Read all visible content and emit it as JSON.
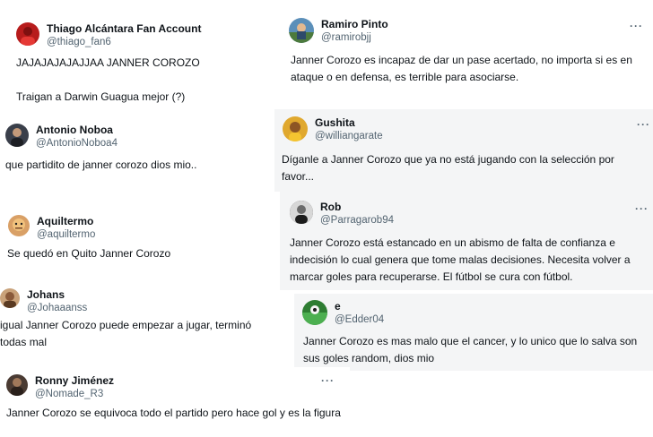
{
  "tweets": [
    {
      "name": "Thiago Alcántara Fan Account",
      "handle": "@thiago_fan6",
      "text": "JAJAJAJAJAJJAA JANNER COROZO\n\nTraigan a Darwin Guagua mejor (?)",
      "avatar": "avatar-red-jersey",
      "avatar_color": "#b71c1c"
    },
    {
      "name": "Ramiro Pinto",
      "handle": "@ramirobjj",
      "text": "Janner Corozo es incapaz de dar un pase acertado, no importa si es en ataque o en defensa, es terrible para asociarse.",
      "avatar": "avatar-outdoor-photo",
      "avatar_color": "#5b8fb9"
    },
    {
      "name": "Antonio Noboa",
      "handle": "@AntonioNoboa4",
      "text": "que partidito de janner corozo dios mio..",
      "avatar": "avatar-portrait",
      "avatar_color": "#3a3f4a"
    },
    {
      "name": "Gushita",
      "handle": "@williangarate",
      "text": "Díganle a Janner Corozo que ya no está jugando con la selección por favor...",
      "avatar": "avatar-yellow",
      "avatar_color": "#e0a82e"
    },
    {
      "name": "Aquiltermo",
      "handle": "@aquiltermo",
      "text": "Se quedó en Quito Janner Corozo",
      "avatar": "avatar-cartoon",
      "avatar_color": "#d9a066"
    },
    {
      "name": "Rob",
      "handle": "@Parragarob94",
      "text": "Janner Corozo está estancado en un abismo de falta de confianza e indecisión lo cual genera que tome malas decisiones. Necesita volver a marcar goles para recuperarse. El fútbol se cura con fútbol.",
      "avatar": "avatar-dark-portrait",
      "avatar_color": "#2b2b2b"
    },
    {
      "name": "Johans",
      "handle": "@Johaaanss",
      "text": "igual Janner Corozo puede empezar a jugar, terminó todas mal",
      "avatar": "avatar-tan",
      "avatar_color": "#c9a27a"
    },
    {
      "name": "e",
      "handle": "@Edder04",
      "text": "Janner Corozo es mas malo que el cancer, y lo unico que lo salva son sus goles random, dios mio",
      "avatar": "avatar-green-field",
      "avatar_color": "#2e7d32"
    },
    {
      "name": "Ronny Jiménez",
      "handle": "@Nomade_R3",
      "text": "Janner Corozo se equivoca todo el partido pero hace gol y es la figura",
      "avatar": "avatar-dark-portrait",
      "avatar_color": "#4a3b33"
    }
  ],
  "more_label": "···"
}
